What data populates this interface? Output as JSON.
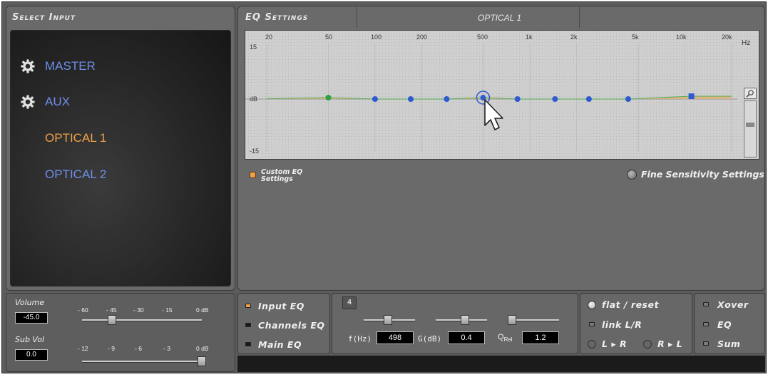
{
  "select_input": {
    "title": "Select Input",
    "items": [
      {
        "label": "MASTER",
        "has_gear": true,
        "color": "#6f8fe8"
      },
      {
        "label": "AUX",
        "has_gear": true,
        "color": "#6f8fe8"
      },
      {
        "label": "OPTICAL 1",
        "has_gear": false,
        "color": "#f0a04a"
      },
      {
        "label": "OPTICAL 2",
        "has_gear": false,
        "color": "#6f8fe8"
      }
    ]
  },
  "eq_settings": {
    "title": "EQ Settings",
    "input_name": "OPTICAL 1",
    "freq_ticks": [
      "20",
      "50",
      "100",
      "200",
      "500",
      "1k",
      "2k",
      "5k",
      "10k",
      "20k"
    ],
    "freq_unit": "Hz",
    "db_top": "15",
    "db_mid": "dB",
    "db_bottom": "-15",
    "custom_eq_label_line1": "Custom EQ",
    "custom_eq_label_line2": "Settings",
    "fine_sensitivity_label": "Fine Sensitivity Settings"
  },
  "chart_data": {
    "type": "line",
    "x_scale": "log",
    "xlim": [
      20,
      20000
    ],
    "ylim": [
      -15,
      15
    ],
    "points": [
      {
        "x": 50,
        "y": 0.4,
        "kind": "low-shelf",
        "color": "#2ea043"
      },
      {
        "x": 100,
        "y": 0,
        "kind": "peak",
        "color": "#2e5bd0"
      },
      {
        "x": 170,
        "y": 0,
        "kind": "peak",
        "color": "#2e5bd0"
      },
      {
        "x": 290,
        "y": 0,
        "kind": "peak",
        "color": "#2e5bd0"
      },
      {
        "x": 498,
        "y": 0.4,
        "kind": "peak-selected",
        "color": "#2e5bd0"
      },
      {
        "x": 830,
        "y": 0,
        "kind": "peak",
        "color": "#2e5bd0"
      },
      {
        "x": 1450,
        "y": 0,
        "kind": "peak",
        "color": "#2e5bd0"
      },
      {
        "x": 2400,
        "y": 0,
        "kind": "peak",
        "color": "#2e5bd0"
      },
      {
        "x": 4300,
        "y": 0,
        "kind": "peak",
        "color": "#2e5bd0"
      },
      {
        "x": 11000,
        "y": 0.8,
        "kind": "high-shelf",
        "color": "#2e5bd0"
      }
    ],
    "curve_color": "#e0b078"
  },
  "volume": {
    "label": "Volume",
    "value": "-45.0",
    "scale": [
      "- 60",
      "- 45",
      "- 30",
      "- 15",
      "0 dB"
    ],
    "level_db": -45,
    "range_db": [
      -60,
      0
    ]
  },
  "sub_vol": {
    "label": "Sub Vol",
    "value": "0.0",
    "scale": [
      "- 12",
      "- 9",
      "- 6",
      "- 3",
      "0 dB"
    ],
    "level_db": 0,
    "range_db": [
      -12,
      0
    ]
  },
  "eq_mode": {
    "options": [
      {
        "label": "Input EQ",
        "active": true
      },
      {
        "label": "Channels EQ",
        "active": false
      },
      {
        "label": "Main EQ",
        "active": false
      }
    ]
  },
  "band": {
    "number": "4",
    "freq_label": "f(Hz)",
    "freq_value": "498",
    "gain_label": "G(dB)",
    "gain_value": "0.4",
    "q_label": "Q",
    "q_sub": "Rel",
    "q_value": "1.2"
  },
  "actions": {
    "flat_reset": "flat / reset",
    "link_lr": "link L/R",
    "l_to_r": "L ▸ R",
    "r_to_l": "R ▸ L"
  },
  "toggles": {
    "xover": "Xover",
    "eq": "EQ",
    "sum": "Sum"
  },
  "colors": {
    "accent_blue": "#6f8fe8",
    "accent_orange": "#f0a04a",
    "active_led": "#f0a04a"
  }
}
